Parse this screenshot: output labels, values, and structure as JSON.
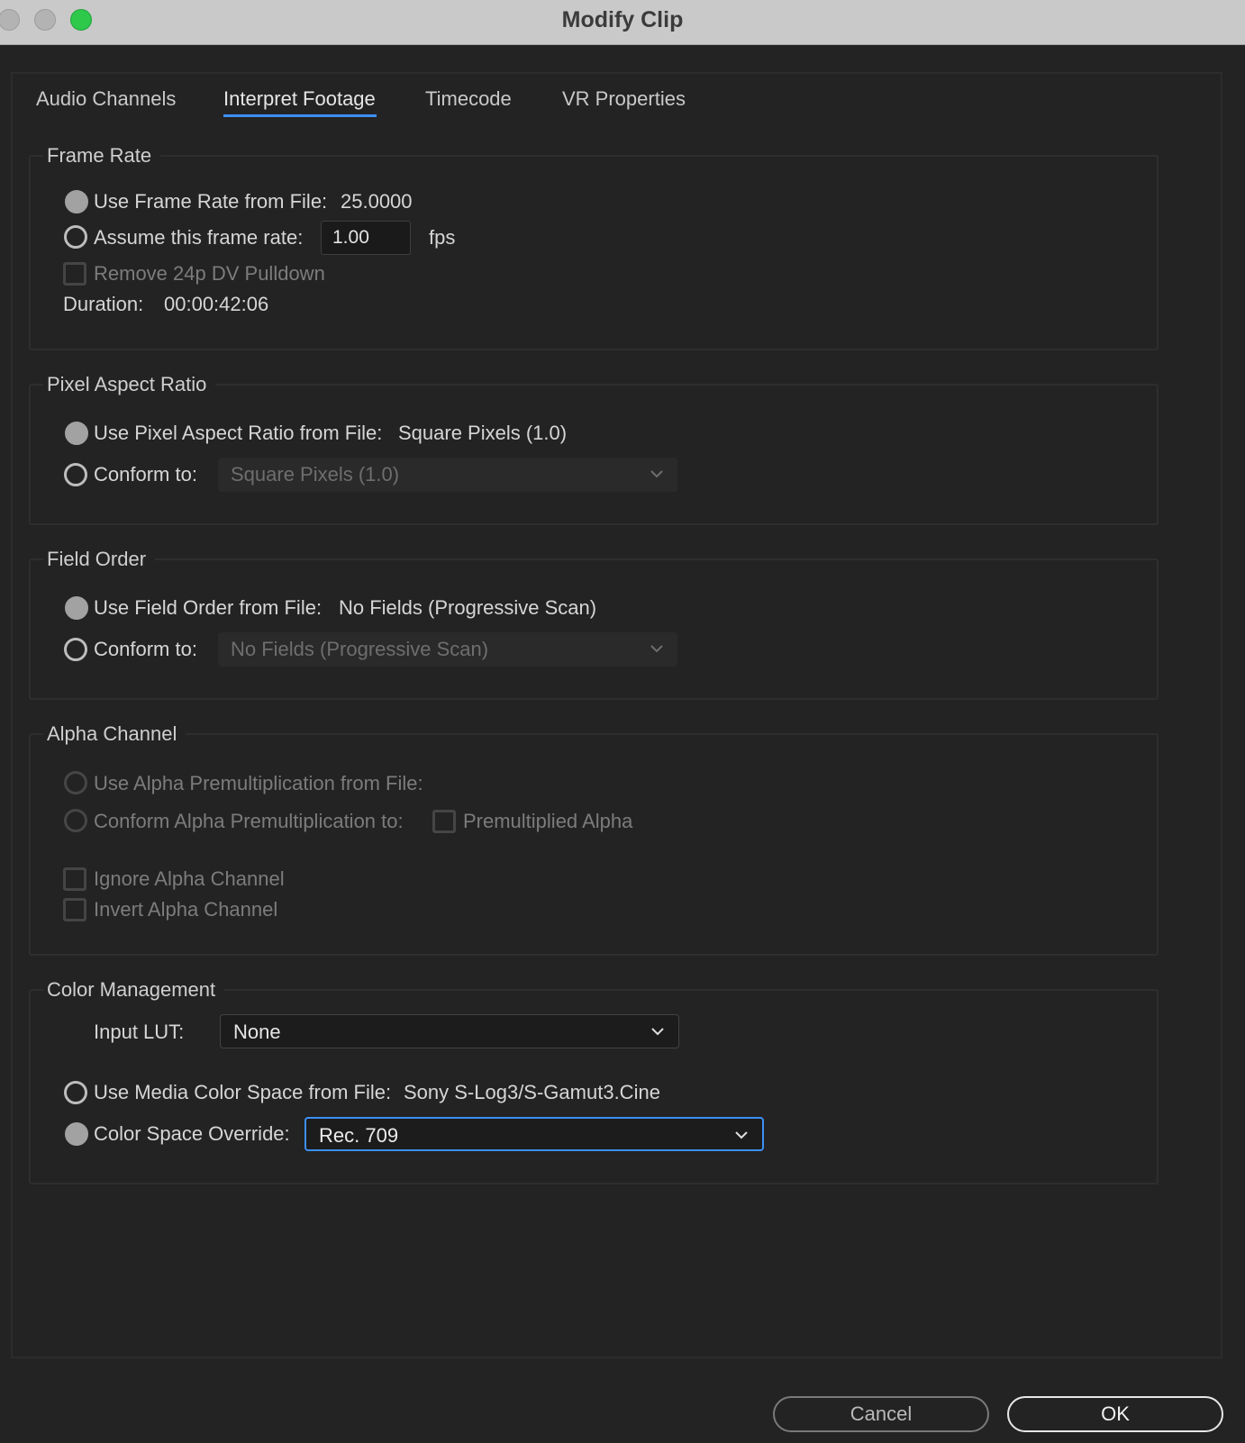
{
  "window": {
    "title": "Modify Clip"
  },
  "tabs": [
    {
      "label": "Audio Channels",
      "active": false
    },
    {
      "label": "Interpret Footage",
      "active": true
    },
    {
      "label": "Timecode",
      "active": false
    },
    {
      "label": "VR Properties",
      "active": false
    }
  ],
  "frame_rate": {
    "title": "Frame Rate",
    "use_from_file_label": "Use Frame Rate from File:",
    "file_value": "25.0000",
    "use_from_file_selected": true,
    "assume_label": "Assume this frame rate:",
    "assume_selected": false,
    "assume_value": "1.00",
    "fps_unit": "fps",
    "remove_pulldown_label": "Remove 24p DV Pulldown",
    "remove_pulldown_checked": false,
    "duration_label": "Duration:",
    "duration_value": "00:00:42:06"
  },
  "pixel_aspect_ratio": {
    "title": "Pixel Aspect Ratio",
    "use_from_file_label": "Use Pixel Aspect Ratio from File:",
    "file_value": "Square Pixels (1.0)",
    "use_from_file_selected": true,
    "conform_label": "Conform to:",
    "conform_selected": false,
    "conform_value": "Square Pixels (1.0)"
  },
  "field_order": {
    "title": "Field Order",
    "use_from_file_label": "Use Field Order from File:",
    "file_value": "No Fields (Progressive Scan)",
    "use_from_file_selected": true,
    "conform_label": "Conform to:",
    "conform_selected": false,
    "conform_value": "No Fields (Progressive Scan)"
  },
  "alpha_channel": {
    "title": "Alpha Channel",
    "use_premult_label": "Use Alpha Premultiplication from File:",
    "conform_premult_label": "Conform Alpha Premultiplication to:",
    "premultiplied_label": "Premultiplied Alpha",
    "ignore_label": "Ignore Alpha Channel",
    "invert_label": "Invert Alpha Channel"
  },
  "color_management": {
    "title": "Color Management",
    "input_lut_label": "Input LUT:",
    "input_lut_value": "None",
    "use_media_label": "Use Media Color Space from File:",
    "media_value": "Sony S-Log3/S-Gamut3.Cine",
    "use_media_selected": false,
    "override_label": "Color Space Override:",
    "override_selected": true,
    "override_value": "Rec. 709"
  },
  "buttons": {
    "cancel": "Cancel",
    "ok": "OK"
  },
  "colors": {
    "accent": "#3d8ff5",
    "background": "#232323",
    "titlebar": "#c9c9c9",
    "zoom_button": "#2ec84a"
  },
  "icons": [
    "chevron-down-icon"
  ]
}
